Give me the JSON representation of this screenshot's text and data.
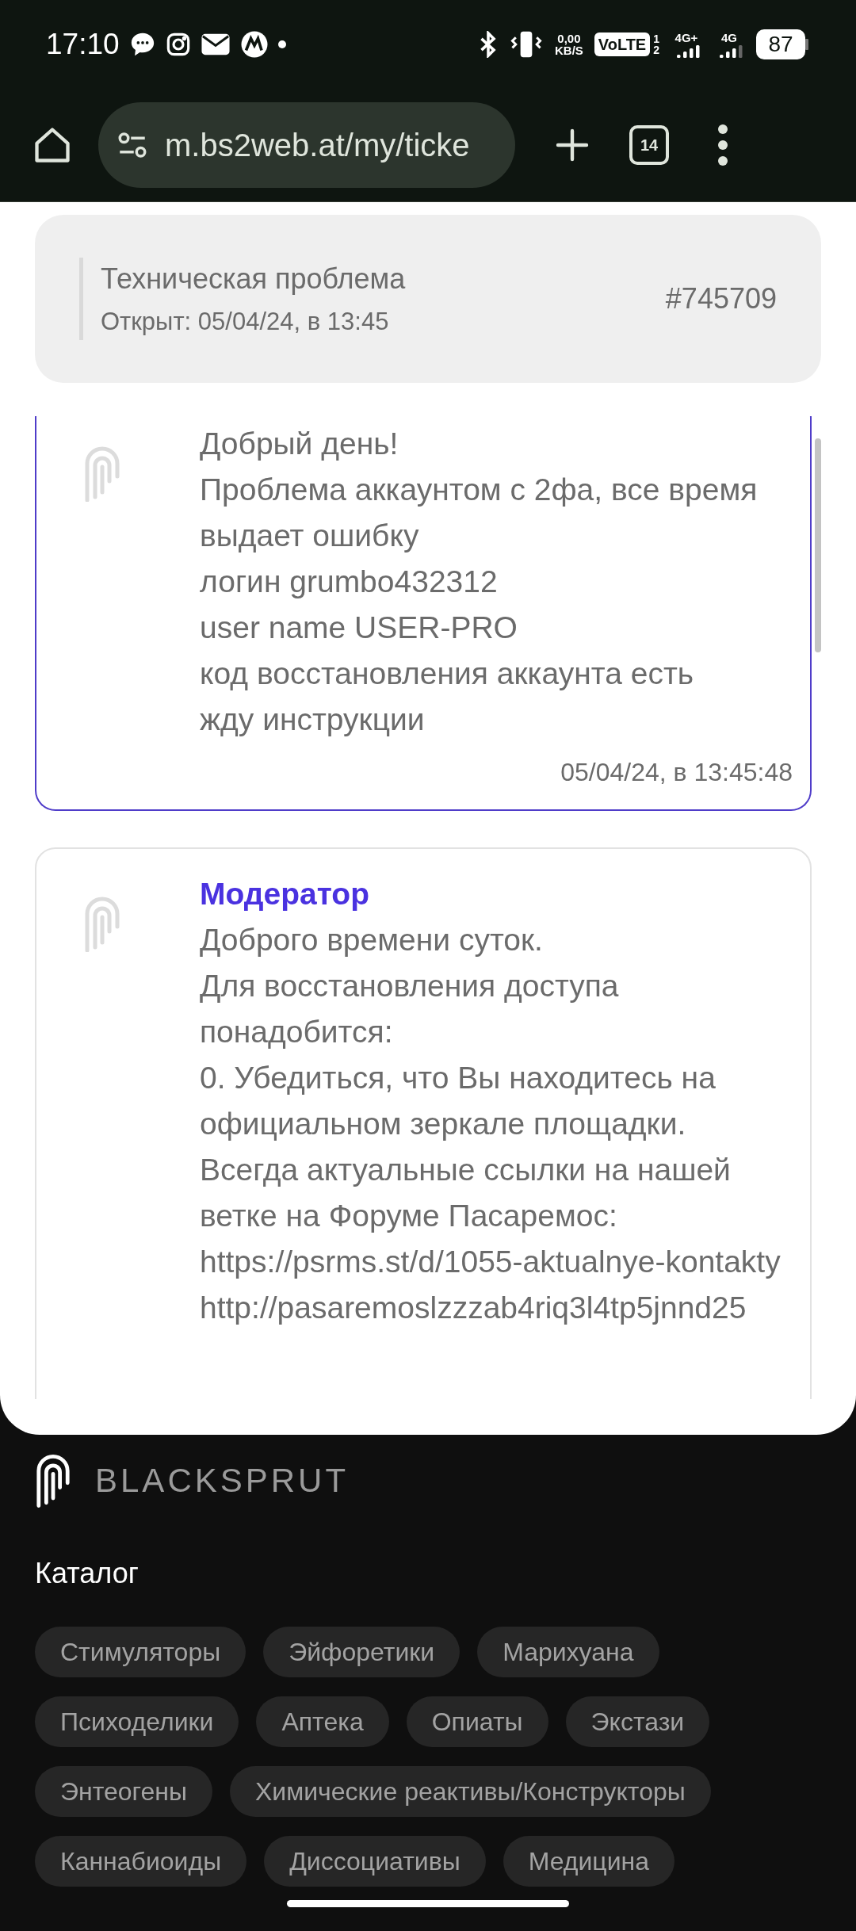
{
  "status_bar": {
    "time": "17:10",
    "speed_value": "0,00",
    "speed_unit": "KB/S",
    "volte": "VoLTE",
    "sim_1": "1",
    "sim_2": "2",
    "network_1": "4G+",
    "network_2": "4G",
    "battery": "87"
  },
  "browser": {
    "url": "m.bs2web.at/my/ticke",
    "tab_count": "14"
  },
  "ticket": {
    "title": "Техническая проблема",
    "opened": "Открыт: 05/04/24, в 13:45",
    "number": "#745709"
  },
  "messages": [
    {
      "kind": "user",
      "lines": [
        "Добрый день!",
        "Проблема аккаунтом с 2фа, все время выдает ошибку",
        "логин grumbo432312",
        "user name USER-PRO",
        "код восстановления аккаунта есть",
        "жду инструкции"
      ],
      "time": "05/04/24, в 13:45:48"
    },
    {
      "kind": "moderator",
      "author": "Модератор",
      "lines": [
        "Доброго времени суток.",
        "Для восстановления доступа понадобится:",
        "0. Убедиться, что Вы находитесь на официальном зеркале площадки.",
        "Всегда актуальные ссылки на нашей ветке на Форуме Пасаремос:",
        "https://psrms.st/d/1055-aktualnye-kontakty",
        "http://pasaremoslzzzab4riq3l4tp5jnnd25"
      ]
    }
  ],
  "footer": {
    "brand": "BLACKSPRUT",
    "catalog_title": "Каталог",
    "categories": [
      "Стимуляторы",
      "Эйфоретики",
      "Марихуана",
      "Психоделики",
      "Аптека",
      "Опиаты",
      "Экстази",
      "Энтеогены",
      "Химические реактивы/Конструкторы",
      "Каннабиоиды",
      "Диссоциативы",
      "Медицина"
    ]
  }
}
